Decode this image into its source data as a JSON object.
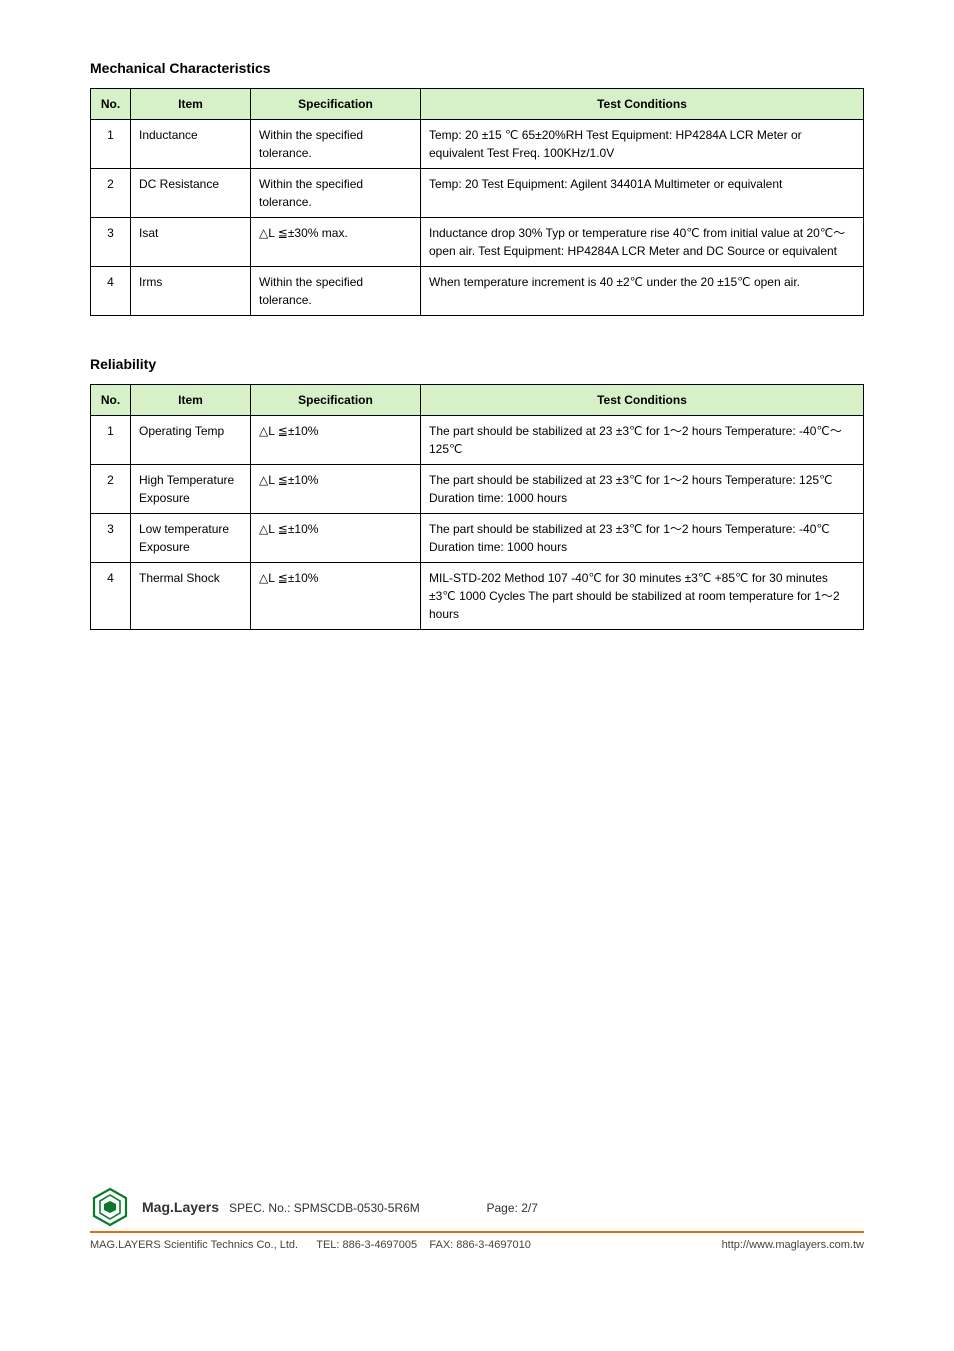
{
  "section1": {
    "title": "Mechanical Characteristics",
    "headers": {
      "no": "No.",
      "item": "Item",
      "spec": "Specification",
      "cond": "Test Conditions"
    },
    "rows": [
      {
        "no": "1",
        "item": "Inductance",
        "spec": "Within the specified tolerance.",
        "cond": "Temp: 20 ±15 ℃ 65±20%RH Test Equipment: HP4284A LCR Meter or equivalent Test Freq. 100KHz/1.0V"
      },
      {
        "no": "2",
        "item": "DC Resistance",
        "spec": "Within the specified tolerance.",
        "cond": "Temp: 20 Test Equipment: Agilent 34401A Multimeter or equivalent"
      },
      {
        "no": "3",
        "item": "Isat",
        "spec": "△L ≦±30% max.",
        "cond": "Inductance drop 30% Typ or temperature rise 40℃ from initial value at 20℃～open air. Test Equipment: HP4284A LCR Meter and DC Source or equivalent"
      },
      {
        "no": "4",
        "item": "Irms",
        "spec": "Within the specified tolerance.",
        "cond": "When temperature increment is 40 ±2℃ under the 20 ±15℃ open air."
      }
    ]
  },
  "section2": {
    "title": "Reliability",
    "headers": {
      "no": "No.",
      "item": "Item",
      "spec": "Specification",
      "cond": "Test Conditions"
    },
    "rows": [
      {
        "no": "1",
        "item": "Operating Temp",
        "spec": "△L ≦±10%",
        "cond": "The part should be stabilized at 23 ±3℃ for 1～2 hours Temperature: -40℃～125℃"
      },
      {
        "no": "2",
        "item": "High Temperature Exposure",
        "spec": "△L ≦±10%",
        "cond": "The part should be stabilized at 23 ±3℃ for 1～2 hours Temperature: 125℃ Duration time: 1000 hours"
      },
      {
        "no": "3",
        "item": "Low temperature Exposure",
        "spec": "△L ≦±10%",
        "cond": "The part should be stabilized at 23 ±3℃ for 1～2 hours Temperature: -40℃ Duration time: 1000 hours"
      },
      {
        "no": "4",
        "item": "Thermal Shock",
        "spec": "△L ≦±10%",
        "cond": "MIL-STD-202 Method 107 -40℃ for 30 minutes ±3℃ +85℃ for 30 minutes ±3℃ 1000 Cycles The part should be stabilized at room temperature for 1～2 hours"
      }
    ]
  },
  "footer": {
    "brand": "Mag.Layers",
    "spec_no_label": "SPEC. No.:",
    "spec_no": "SPMSCDB-0530-5R6M",
    "page_label": "Page:",
    "page": "2/7",
    "company": "MAG.LAYERS Scientific Technics Co., Ltd.",
    "tel_label": "TEL:",
    "tel": "886-3-4697005",
    "fax_label": "FAX:",
    "fax": "886-3-4697010",
    "url": "http://www.maglayers.com.tw"
  }
}
